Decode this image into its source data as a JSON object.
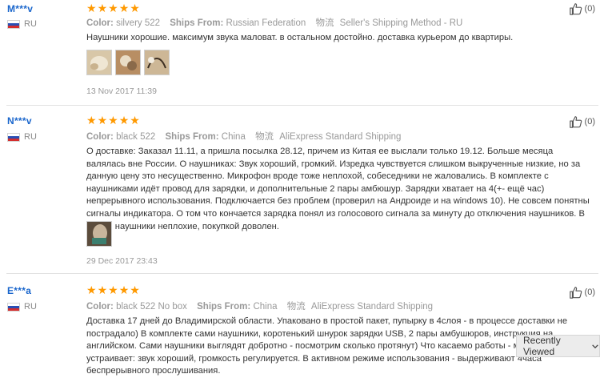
{
  "reviews": [
    {
      "user": "M***v",
      "country": "RU",
      "color_label": "Color:",
      "color_value": "silvery 522",
      "ships_label": "Ships From:",
      "ships_value": "Russian Federation",
      "logistics_icon_text": "物流",
      "logistics": "Seller's Shipping Method - RU",
      "text": "Наушники хорошие. максимум звука маловат. в остальном достойно. доставка курьером до квартиры.",
      "photos": [
        "photo-1",
        "photo-2",
        "photo-3"
      ],
      "date": "13 Nov 2017 11:39",
      "likes": "(0)",
      "stars": 5
    },
    {
      "user": "N***v",
      "country": "RU",
      "color_label": "Color:",
      "color_value": "black 522",
      "ships_label": "Ships From:",
      "ships_value": "China",
      "logistics_icon_text": "物流",
      "logistics": "AliExpress Standard Shipping",
      "text": "О доставке: Заказал 11.11, а пришла посылка 28.12, причем из Китая ее выслали только 19.12. Больше месяца валялась вне России. О наушниках: Звук хороший, громкий. Изредка чувствуется слишком выкрученные низкие, но за данную цену это несущественно. Микрофон вроде тоже неплохой, собеседники не жаловались. В комплекте с наушниками идёт провод для зарядки, и дополнительные 2 пары амбюшур. Зарядки хватает на 4(+- ещё час) непрерывного использования. Подключается без проблем (проверил на Андроиде и на windows 10). Не совсем понятны сигналы индикатора. О том что кончается зарядка понял из голосового сигнала за минуту до отключения наушников. В целом наушники неплохие, покупкой доволен.",
      "photos": [
        "photo-1"
      ],
      "date": "29 Dec 2017 23:43",
      "likes": "(0)",
      "stars": 5
    },
    {
      "user": "E***a",
      "country": "RU",
      "color_label": "Color:",
      "color_value": "black 522 No box",
      "ships_label": "Ships From:",
      "ships_value": "China",
      "logistics_icon_text": "物流",
      "logistics": "AliExpress Standard Shipping",
      "text": "Доставка 17 дней до Владимирской области. Упаковано в простой пакет, пупырку в 4слоя - в процессе доставки не пострадало) В комплекте сами наушники, коротенький шнурок зарядки USB, 2 пары амбушюров, инструкция на английском. Сами наушники выглядят добротно - посмотрим сколько протянут) Что касаемо работы - меня все устраивает: звук хороший, громкость регулируется. В активном режиме использования - выдерживают 4часа беспрерывного прослушивания.",
      "photos": [],
      "date": "",
      "likes": "(0)",
      "stars": 5
    }
  ],
  "recently_viewed": {
    "label": "Recently Viewed"
  },
  "colors": {
    "star": "#ff9900",
    "username": "#1a66cc",
    "meta": "#999999"
  }
}
